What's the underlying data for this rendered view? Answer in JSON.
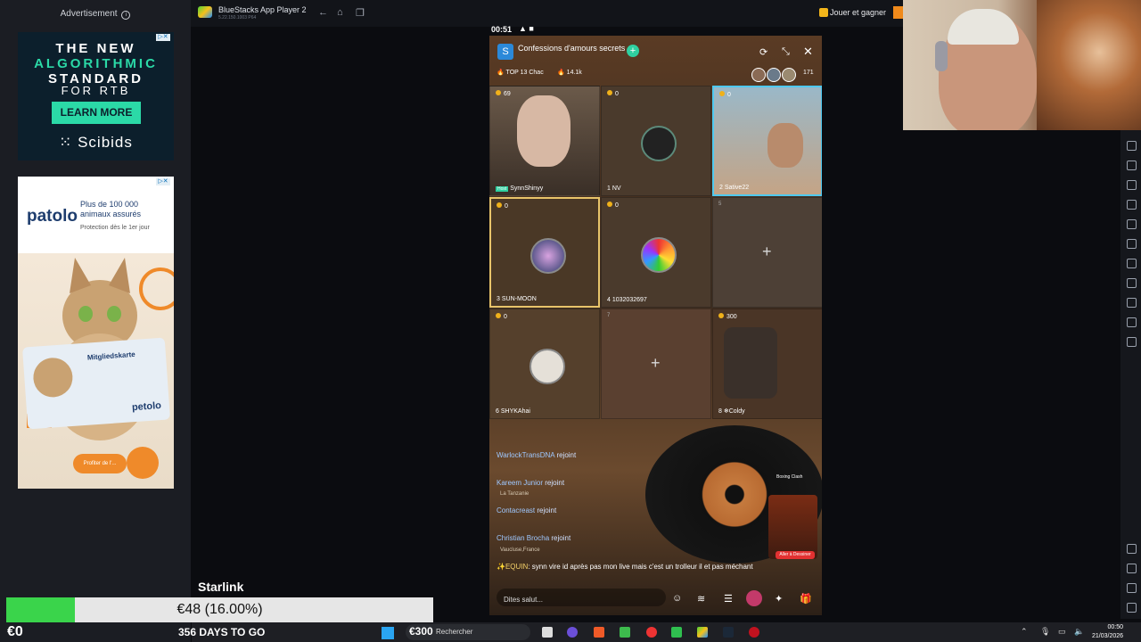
{
  "ads": {
    "header": "Advertisement",
    "scibids": {
      "line1": "THE NEW",
      "line2": "ALGORITHMIC",
      "line3": "STANDARD",
      "line4": "FOR RTB",
      "cta": "LEARN MORE",
      "brand": "Scibids"
    },
    "patolo": {
      "logo": "patolo",
      "headline": "Plus de 100 000 animaux assurés",
      "sub": "Protection dès le 1er jour",
      "card_title": "Mitgliedskarte",
      "card_logo": "petolo",
      "cta": "Profiter de l'..."
    }
  },
  "bluestacks": {
    "title": "BlueStacks App Player 2",
    "subtitle": "5.22.150.1003 P64",
    "play_label": "Jouer et gagner"
  },
  "phone": {
    "status_time": "00:51",
    "room": {
      "icon_letter": "S",
      "name": "Confessions d'amours secrets",
      "rank": "TOP 13 Chac",
      "likes": "14.1k",
      "viewers": "171"
    },
    "seats": [
      {
        "count": "69",
        "name": "SynnShinyy",
        "host_tag": "Host",
        "type": "video"
      },
      {
        "count": "0",
        "index": "1",
        "name": "NV",
        "type": "avatar"
      },
      {
        "count": "0",
        "index": "2",
        "name": "Sative22",
        "type": "video"
      },
      {
        "count": "0",
        "index": "3",
        "name": "SUN-MOON",
        "type": "avatar"
      },
      {
        "count": "0",
        "index": "4",
        "name": "1032032697",
        "type": "avatar"
      },
      {
        "count": "",
        "index": "5",
        "name": "",
        "type": "empty"
      },
      {
        "count": "0",
        "index": "6",
        "name": "SHYKAhai",
        "type": "avatar"
      },
      {
        "count": "",
        "index": "7",
        "name": "",
        "type": "empty"
      },
      {
        "count": "300",
        "index": "8",
        "name": "❄Coldy",
        "type": "avatar"
      }
    ],
    "chat": [
      {
        "user": "WarlockTransDNA",
        "action": "rejoint",
        "sub": ""
      },
      {
        "user": "Kareem Junior",
        "action": "rejoint",
        "sub": "La Tanzanie"
      },
      {
        "user": "Contacreast",
        "action": "rejoint",
        "sub": ""
      },
      {
        "user": "Christian Brocha",
        "action": "rejoint",
        "sub": "Vaucluse,France"
      }
    ],
    "message_user": "✨EQUIN",
    "message_text": ": synn vire id après pas mon live mais c'est un trolleur  il et pas méchant",
    "input_placeholder": "Dites salut...",
    "game_title": "Boxing Clash",
    "game_cta": "Aller à Dessiner"
  },
  "overlay": {
    "streamer_label": "Starlink",
    "goal_text": "€48 (16.00%)",
    "goal_progress": 0.16,
    "balance": "€0",
    "days": "356 DAYS TO GO",
    "bonus": "€300"
  },
  "taskbar": {
    "search_placeholder": "Rechercher",
    "time": "00:50",
    "date": "21/03/2026"
  },
  "colors": {
    "progress_fill": "#3ad44b",
    "scibids_accent": "#2bd9a7",
    "patolo_brand": "#1e3d6e"
  }
}
